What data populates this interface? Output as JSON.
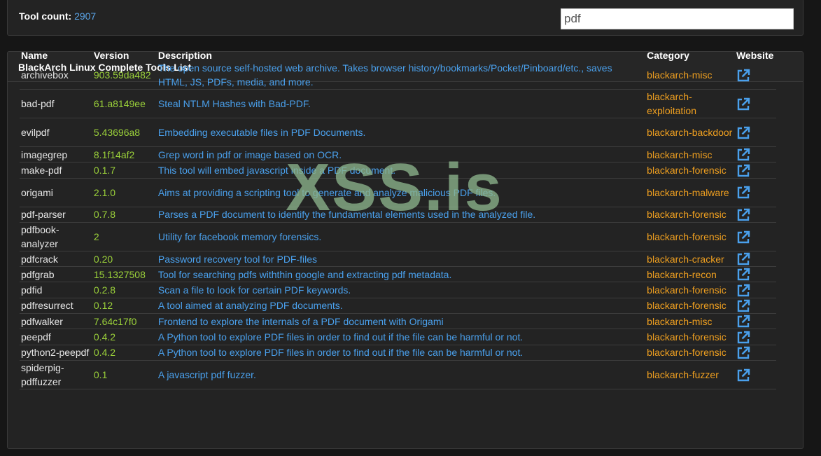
{
  "header": {
    "count_label": "Tool count:",
    "count_value": "2907",
    "search_value": "pdf"
  },
  "panel": {
    "title": "BlackArch Linux Complete Tools List"
  },
  "table": {
    "columns": [
      "Name",
      "Version",
      "Description",
      "Category",
      "Website"
    ],
    "rows": [
      {
        "name": "archivebox",
        "version": "903.59da482",
        "description": "The open source self-hosted web archive. Takes browser history/bookmarks/Pocket/Pinboard/etc., saves HTML, JS, PDFs, media, and more.",
        "category": "blackarch-misc",
        "tall": true
      },
      {
        "name": "bad-pdf",
        "version": "61.a8149ee",
        "description": "Steal NTLM Hashes with Bad-PDF.",
        "category": "blackarch-exploitation",
        "tall": true
      },
      {
        "name": "evilpdf",
        "version": "5.43696a8",
        "description": "Embedding executable files in PDF Documents.",
        "category": "blackarch-backdoor",
        "tall": true
      },
      {
        "name": "imagegrep",
        "version": "8.1f14af2",
        "description": "Grep word in pdf or image based on OCR.",
        "category": "blackarch-misc",
        "tall": false
      },
      {
        "name": "make-pdf",
        "version": "0.1.7",
        "description": "This tool will embed javascript inside a PDF document.",
        "category": "blackarch-forensic",
        "tall": false
      },
      {
        "name": "origami",
        "version": "2.1.0",
        "description": "Aims at providing a scripting tool to generate and analyze malicious PDF files.",
        "category": "blackarch-malware",
        "tall": true
      },
      {
        "name": "pdf-parser",
        "version": "0.7.8",
        "description": "Parses a PDF document to identify the fundamental elements used in the analyzed file.",
        "category": "blackarch-forensic",
        "tall": false
      },
      {
        "name": "pdfbook-analyzer",
        "version": "2",
        "description": "Utility for facebook memory forensics.",
        "category": "blackarch-forensic",
        "tall": true
      },
      {
        "name": "pdfcrack",
        "version": "0.20",
        "description": "Password recovery tool for PDF-files",
        "category": "blackarch-cracker",
        "tall": false
      },
      {
        "name": "pdfgrab",
        "version": "15.1327508",
        "description": "Tool for searching pdfs withthin google and extracting pdf metadata.",
        "category": "blackarch-recon",
        "tall": false
      },
      {
        "name": "pdfid",
        "version": "0.2.8",
        "description": "Scan a file to look for certain PDF keywords.",
        "category": "blackarch-forensic",
        "tall": false
      },
      {
        "name": "pdfresurrect",
        "version": "0.12",
        "description": "A tool aimed at analyzing PDF documents.",
        "category": "blackarch-forensic",
        "tall": false
      },
      {
        "name": "pdfwalker",
        "version": "7.64c17f0",
        "description": "Frontend to explore the internals of a PDF document with Origami",
        "category": "blackarch-misc",
        "tall": false
      },
      {
        "name": "peepdf",
        "version": "0.4.2",
        "description": "A Python tool to explore PDF files in order to find out if the file can be harmful or not.",
        "category": "blackarch-forensic",
        "tall": false
      },
      {
        "name": "python2-peepdf",
        "version": "0.4.2",
        "description": "A Python tool to explore PDF files in order to find out if the file can be harmful or not.",
        "category": "blackarch-forensic",
        "tall": false
      },
      {
        "name": "spiderpig-pdffuzzer",
        "version": "0.1",
        "description": "A javascript pdf fuzzer.",
        "category": "blackarch-fuzzer",
        "tall": true
      }
    ]
  },
  "watermark": "XSS.is",
  "colors": {
    "link": "#4aa0ec",
    "version": "#9bd13a",
    "category": "#f0a020",
    "background": "#161616",
    "panel": "#232323"
  },
  "icons": {
    "website": "external-link-icon"
  }
}
